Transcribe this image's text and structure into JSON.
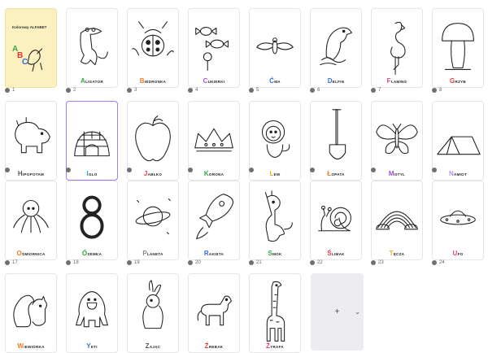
{
  "cards": [
    {
      "num": "1",
      "kind": "cover",
      "title": "Kolorowy ALFABET",
      "cover_letters": [
        {
          "ch": "A",
          "color": "#3aa84a"
        },
        {
          "ch": "B",
          "color": "#e53030"
        },
        {
          "ch": "C",
          "color": "#2e6fd8"
        }
      ]
    },
    {
      "num": "2",
      "kind": "crocodile",
      "initial": "A",
      "rest": "LIGATOR",
      "color": "#2fa847"
    },
    {
      "num": "3",
      "kind": "ladybug",
      "initial": "B",
      "rest": "IEDRONKA",
      "color": "#f07d24"
    },
    {
      "num": "4",
      "kind": "candy",
      "initial": "C",
      "rest": "UKIERKI",
      "color": "#b24dd8"
    },
    {
      "num": "5",
      "kind": "cicada",
      "initial": "Ć",
      "rest": "MA",
      "color": "#2e6fd8"
    },
    {
      "num": "6",
      "kind": "dolphin",
      "initial": "D",
      "rest": "ELFIN",
      "color": "#2e6fd8"
    },
    {
      "num": "7",
      "kind": "flamingo",
      "initial": "F",
      "rest": "LAMING",
      "color": "#e0457b"
    },
    {
      "num": "8",
      "kind": "mushroom",
      "initial": "G",
      "rest": "RZYB",
      "color": "#e23e3e"
    },
    {
      "num": "",
      "kind": "hippo",
      "initial": "H",
      "rest": "IPOPOTAM",
      "color": "#555555"
    },
    {
      "num": "",
      "kind": "igloo",
      "initial": "I",
      "rest": "GLO",
      "color": "#2aa8c8"
    },
    {
      "num": "",
      "kind": "apple",
      "initial": "J",
      "rest": "ABŁKO",
      "color": "#e23e3e"
    },
    {
      "num": "",
      "kind": "crown",
      "initial": "K",
      "rest": "ORONA",
      "color": "#2fa847"
    },
    {
      "num": "",
      "kind": "lion",
      "initial": "L",
      "rest": "EW",
      "color": "#f0b020"
    },
    {
      "num": "",
      "kind": "shovel",
      "initial": "Ł",
      "rest": "OPATA",
      "color": "#f07d24"
    },
    {
      "num": "",
      "kind": "butterfly",
      "initial": "M",
      "rest": "OTYL",
      "color": "#9a4fd0"
    },
    {
      "num": "",
      "kind": "tent",
      "initial": "N",
      "rest": "AMIOT",
      "color": "#b98fe8"
    },
    {
      "num": "17",
      "kind": "octopus",
      "initial": "O",
      "rest": "ŚMIORNICA",
      "color": "#f07d24"
    },
    {
      "num": "18",
      "kind": "eight",
      "initial": "Ó",
      "rest": "SEMKA",
      "color": "#2fa847"
    },
    {
      "num": "19",
      "kind": "planet",
      "initial": "P",
      "rest": "LANETA",
      "color": "#888888"
    },
    {
      "num": "20",
      "kind": "rocket",
      "initial": "R",
      "rest": "AKIETA",
      "color": "#2e6fd8"
    },
    {
      "num": "21",
      "kind": "dragon",
      "initial": "S",
      "rest": "MOK",
      "color": "#2fa847"
    },
    {
      "num": "22",
      "kind": "snail",
      "initial": "Ś",
      "rest": "LIMAK",
      "color": "#e23e3e"
    },
    {
      "num": "23",
      "kind": "rainbow",
      "initial": "T",
      "rest": "ĘCZA",
      "color": "#f0b020"
    },
    {
      "num": "24",
      "kind": "ufo",
      "initial": "U",
      "rest": "FO",
      "color": "#e0457b"
    },
    {
      "num": "",
      "kind": "squirrel",
      "initial": "W",
      "rest": "IEWIÓRKA",
      "color": "#f07d24"
    },
    {
      "num": "",
      "kind": "yeti",
      "initial": "Y",
      "rest": "ETI",
      "color": "#2e6fd8"
    },
    {
      "num": "",
      "kind": "hare",
      "initial": "Z",
      "rest": "AJĄC",
      "color": "#555555"
    },
    {
      "num": "",
      "kind": "horse",
      "initial": "Ź",
      "rest": "REBAK",
      "color": "#e23e3e"
    },
    {
      "num": "",
      "kind": "giraffe",
      "initial": "Ż",
      "rest": "YRAFA",
      "color": "#e0457b"
    }
  ],
  "add_tile": {
    "plus": "+",
    "chevron": "⌄"
  }
}
